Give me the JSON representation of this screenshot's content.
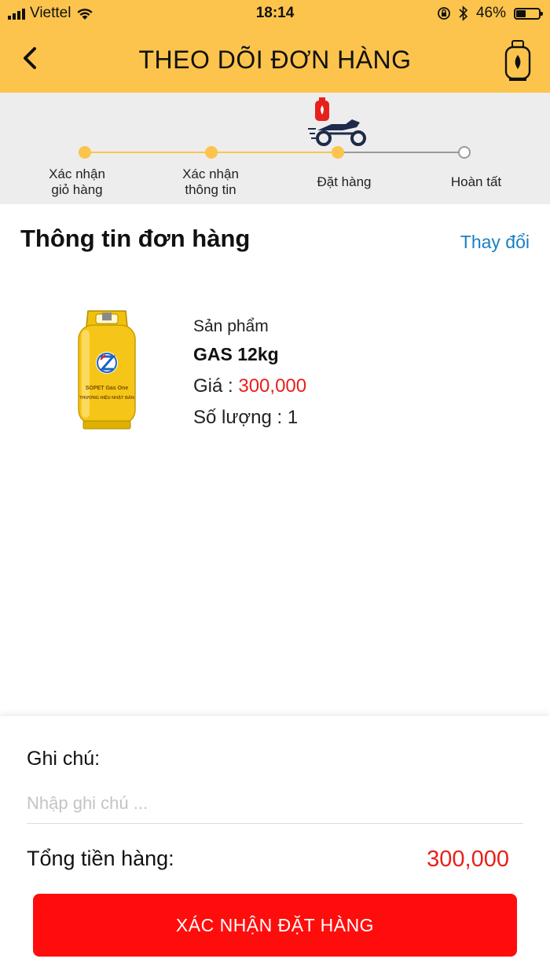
{
  "status_bar": {
    "carrier": "Viettel",
    "time": "18:14",
    "battery": "46%",
    "battery_level": 0.46
  },
  "header": {
    "title": "THEO DÕI ĐƠN HÀNG",
    "back_icon": "chevron-left-icon",
    "right_icon": "gas-cylinder-icon"
  },
  "progress": {
    "steps": [
      {
        "label_line1": "Xác nhận",
        "label_line2": "giỏ hàng",
        "state": "done"
      },
      {
        "label_line1": "Xác nhận",
        "label_line2": "thông tin",
        "state": "done"
      },
      {
        "label_line1": "Đặt hàng",
        "label_line2": "",
        "state": "current"
      },
      {
        "label_line1": "Hoàn tất",
        "label_line2": "",
        "state": "pending"
      }
    ],
    "current_icon": "delivery-motorbike-icon",
    "active_color": "#fcc44c",
    "inactive_color": "#9a9a9a"
  },
  "order": {
    "section_title": "Thông tin đơn hàng",
    "change_link": "Thay đổi",
    "product": {
      "label": "Sản phẩm",
      "name": "GAS 12kg",
      "price_label": "Giá : ",
      "price": "300,000",
      "quantity": "Số lượng : 1",
      "image_icon": "gas-cylinder-product-image",
      "cylinder_text_1": "SOPET Gas One",
      "cylinder_text_2": "THƯƠNG HIỆU NHẬT BẢN"
    }
  },
  "footer": {
    "note_label": "Ghi chú:",
    "note_placeholder": "Nhập ghi chú ...",
    "note_value": "",
    "total_label": "Tổng tiền hàng:",
    "total_value": "300,000",
    "confirm_button": "XÁC NHẬN ĐẶT HÀNG"
  },
  "colors": {
    "brand_yellow": "#fcc44c",
    "price_red": "#e8201b",
    "button_red": "#ff0d0d",
    "link_blue": "#1a7fc3"
  }
}
